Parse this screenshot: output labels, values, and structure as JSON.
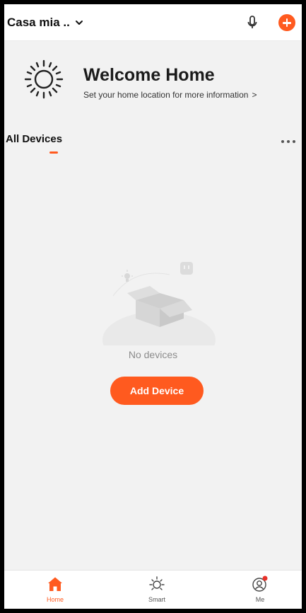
{
  "header": {
    "home_name": "Casa mia ..",
    "icons": {
      "dropdown": "chevron-down-icon",
      "mic": "microphone-icon",
      "add": "plus-circle-icon"
    }
  },
  "welcome": {
    "title": "Welcome Home",
    "subtitle": "Set your home location for more information",
    "chevron": ">"
  },
  "devices_tab": {
    "label": "All Devices",
    "more_icon": "more-horizontal-icon"
  },
  "empty_state": {
    "message": "No devices",
    "add_button": "Add Device"
  },
  "bottom_nav": {
    "items": [
      {
        "label": "Home",
        "icon": "home-icon",
        "active": true
      },
      {
        "label": "Smart",
        "icon": "sun-icon",
        "active": false
      },
      {
        "label": "Me",
        "icon": "user-icon",
        "active": false
      }
    ]
  },
  "colors": {
    "accent": "#ff5a1f",
    "background": "#f2f2f2",
    "surface": "#ffffff",
    "text": "#111111",
    "muted": "#8c8c8c"
  }
}
